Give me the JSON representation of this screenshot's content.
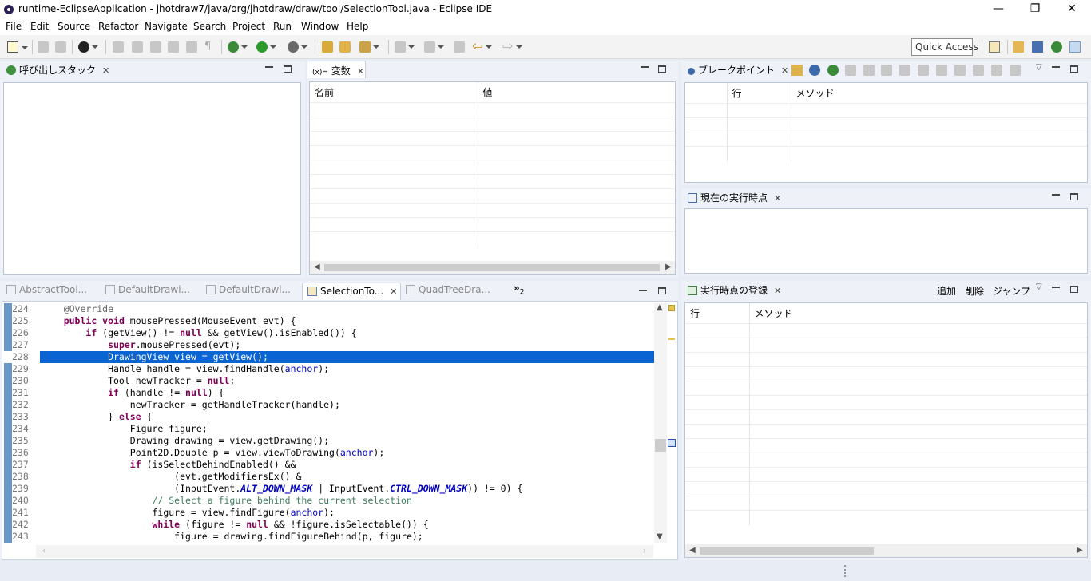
{
  "window": {
    "title": "runtime-EclipseApplication - jhotdraw7/java/org/jhotdraw/draw/tool/SelectionTool.java - Eclipse IDE",
    "minimize": "—",
    "restore": "❐",
    "close": "✕"
  },
  "menu": [
    "File",
    "Edit",
    "Source",
    "Refactor",
    "Navigate",
    "Search",
    "Project",
    "Run",
    "Window",
    "Help"
  ],
  "quick_access": {
    "placeholder": "Quick Access"
  },
  "callstack_view": {
    "title": "呼び出しスタック"
  },
  "variables_view": {
    "title": "変数",
    "icon_label": "(x)=",
    "columns": [
      "名前",
      "値"
    ]
  },
  "breakpoints_view": {
    "title": "ブレークポイント",
    "columns": [
      "",
      "行",
      "メソッド"
    ]
  },
  "current_point_view": {
    "title": "現在の実行時点"
  },
  "registry_view": {
    "title": "実行時点の登録",
    "actions": [
      "追加",
      "削除",
      "ジャンプ"
    ],
    "columns": [
      "行",
      "メソッド"
    ]
  },
  "editor": {
    "tabs": [
      "AbstractTool...",
      "DefaultDrawi...",
      "DefaultDrawi...",
      "SelectionTo...",
      "QuadTreeDra..."
    ],
    "active_tab": 3,
    "overflow_label": "»",
    "overflow_count": "2",
    "selected_line": "228",
    "lines": [
      {
        "n": "224",
        "t": "    @Override"
      },
      {
        "n": "225",
        "t": "    public void mousePressed(MouseEvent evt) {"
      },
      {
        "n": "226",
        "t": "        if (getView() != null && getView().isEnabled()) {"
      },
      {
        "n": "227",
        "t": "            super.mousePressed(evt);"
      },
      {
        "n": "228",
        "t": "            DrawingView view = getView();"
      },
      {
        "n": "229",
        "t": "            Handle handle = view.findHandle(anchor);"
      },
      {
        "n": "230",
        "t": "            Tool newTracker = null;"
      },
      {
        "n": "231",
        "t": "            if (handle != null) {"
      },
      {
        "n": "232",
        "t": "                newTracker = getHandleTracker(handle);"
      },
      {
        "n": "233",
        "t": "            } else {"
      },
      {
        "n": "234",
        "t": "                Figure figure;"
      },
      {
        "n": "235",
        "t": "                Drawing drawing = view.getDrawing();"
      },
      {
        "n": "236",
        "t": "                Point2D.Double p = view.viewToDrawing(anchor);"
      },
      {
        "n": "237",
        "t": "                if (isSelectBehindEnabled() &&"
      },
      {
        "n": "238",
        "t": "                        (evt.getModifiersEx() &"
      },
      {
        "n": "239",
        "t": "                        (InputEvent.ALT_DOWN_MASK | InputEvent.CTRL_DOWN_MASK)) != 0) {"
      },
      {
        "n": "240",
        "t": "                    // Select a figure behind the current selection"
      },
      {
        "n": "241",
        "t": "                    figure = view.findFigure(anchor);"
      },
      {
        "n": "242",
        "t": "                    while (figure != null && !figure.isSelectable()) {"
      },
      {
        "n": "243",
        "t": "                        figure = drawing.findFigureBehind(p, figure);"
      }
    ]
  }
}
